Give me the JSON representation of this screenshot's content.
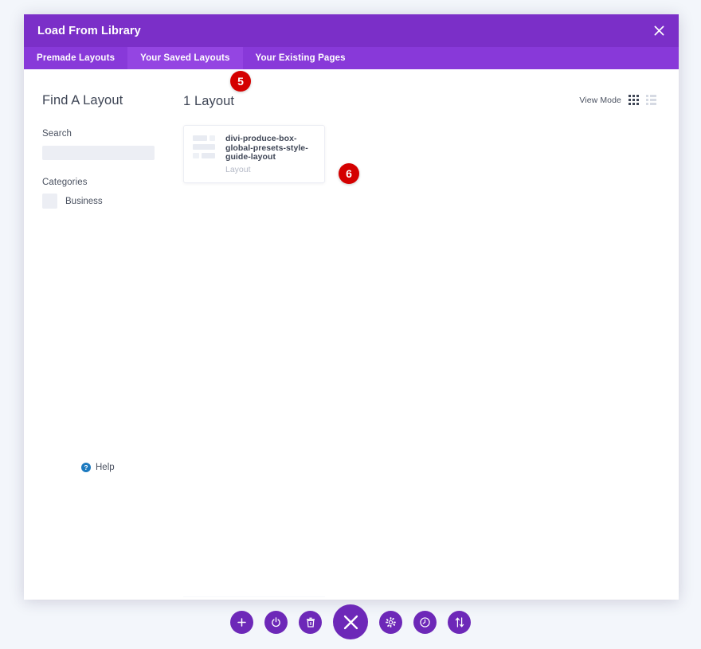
{
  "modal": {
    "title": "Load From Library",
    "close_label": "×"
  },
  "tabs": [
    {
      "label": "Premade Layouts",
      "active": false
    },
    {
      "label": "Your Saved Layouts",
      "active": true
    },
    {
      "label": "Your Existing Pages",
      "active": false
    }
  ],
  "sidebar": {
    "title": "Find A Layout",
    "search_label": "Search",
    "search_value": "",
    "search_placeholder": "",
    "categories_label": "Categories",
    "categories": [
      {
        "label": "Business",
        "checked": false
      }
    ],
    "help_label": "Help"
  },
  "content": {
    "count_title": "1 Layout",
    "view_mode_label": "View Mode",
    "view_modes": [
      {
        "name": "grid",
        "active": true
      },
      {
        "name": "list",
        "active": false
      }
    ],
    "layouts": [
      {
        "name": "divi-produce-box-global-presets-style-guide-layout",
        "type": "Layout"
      }
    ]
  },
  "badges": [
    {
      "id": "badge-5",
      "label": "5"
    },
    {
      "id": "badge-6",
      "label": "6"
    }
  ],
  "toolbar": {
    "buttons": [
      {
        "name": "add-section-button",
        "icon": "plus-icon",
        "size": "small"
      },
      {
        "name": "page-settings-button",
        "icon": "power-icon",
        "size": "small"
      },
      {
        "name": "clear-layout-button",
        "icon": "trash-icon",
        "size": "small"
      },
      {
        "name": "close-builder-button",
        "icon": "close-icon",
        "size": "large"
      },
      {
        "name": "settings-button",
        "icon": "gear-icon",
        "size": "small"
      },
      {
        "name": "history-button",
        "icon": "clock-icon",
        "size": "small"
      },
      {
        "name": "reorder-button",
        "icon": "updown-arrows-icon",
        "size": "small"
      }
    ]
  },
  "colors": {
    "header_purple": "#7b2fc8",
    "tabbar_purple": "#8839d9",
    "active_tab_purple": "#9445e2",
    "toolbar_purple": "#6d28b8",
    "badge_red": "#d40000",
    "page_background": "#f3f6fb"
  }
}
